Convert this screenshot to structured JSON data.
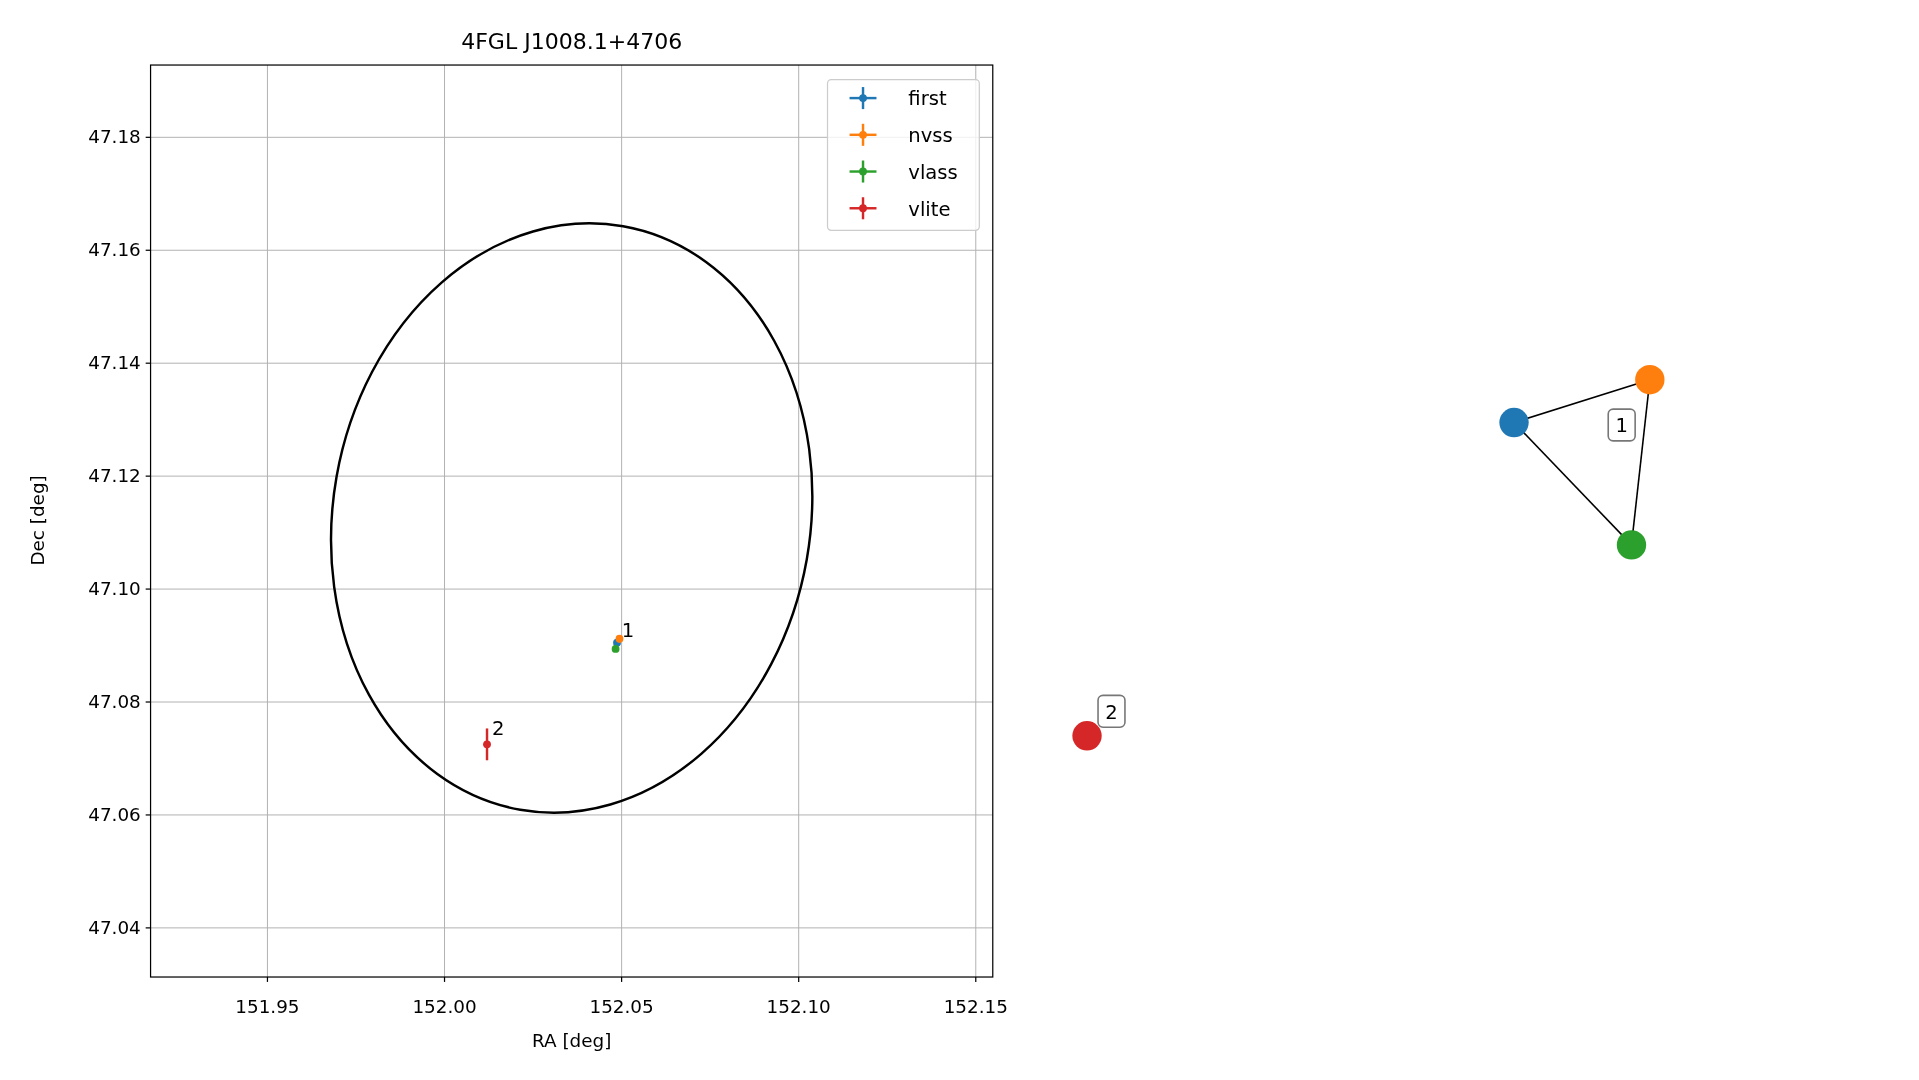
{
  "chart_data": {
    "type": "scatter",
    "title": "4FGL J1008.1+4706",
    "xlabel": "RA [deg]",
    "ylabel": "Dec [deg]",
    "series": [
      {
        "name": "first",
        "color": "#1f77b4",
        "x": [
          152.0487
        ],
        "values": [
          47.0905
        ]
      },
      {
        "name": "nvss",
        "color": "#ff7f0e",
        "x": [
          152.0494
        ],
        "values": [
          47.0912
        ]
      },
      {
        "name": "vlass",
        "color": "#2ca02c",
        "x": [
          152.0483
        ],
        "values": [
          47.0894
        ]
      },
      {
        "name": "vlite",
        "color": "#d62728",
        "x": [
          152.012
        ],
        "values": [
          47.0725
        ]
      }
    ],
    "xlim": [
      151.917,
      152.1548
    ],
    "ylim": [
      47.0313,
      47.1928
    ],
    "xticks": [
      {
        "value": 151.95,
        "label": "151.95"
      },
      {
        "value": 152.0,
        "label": "152.00"
      },
      {
        "value": 152.05,
        "label": "152.05"
      },
      {
        "value": 152.1,
        "label": "152.10"
      },
      {
        "value": 152.15,
        "label": "152.15"
      }
    ],
    "yticks": [
      {
        "value": 47.04,
        "label": "47.04"
      },
      {
        "value": 47.06,
        "label": "47.06"
      },
      {
        "value": 47.08,
        "label": "47.08"
      },
      {
        "value": 47.1,
        "label": "47.10"
      },
      {
        "value": 47.12,
        "label": "47.12"
      },
      {
        "value": 47.14,
        "label": "47.14"
      },
      {
        "value": 47.16,
        "label": "47.16"
      },
      {
        "value": 47.18,
        "label": "47.18"
      }
    ],
    "annotations": [
      "1",
      "2"
    ],
    "grid": true,
    "legend": "upper right"
  },
  "graph": {
    "nodes": [
      {
        "color": "#1f77b4"
      },
      {
        "color": "#ff7f0e"
      },
      {
        "color": "#2ca02c"
      },
      {
        "color": "#d62728"
      }
    ],
    "clusters": [
      {
        "label": "1"
      },
      {
        "label": "2"
      }
    ]
  }
}
